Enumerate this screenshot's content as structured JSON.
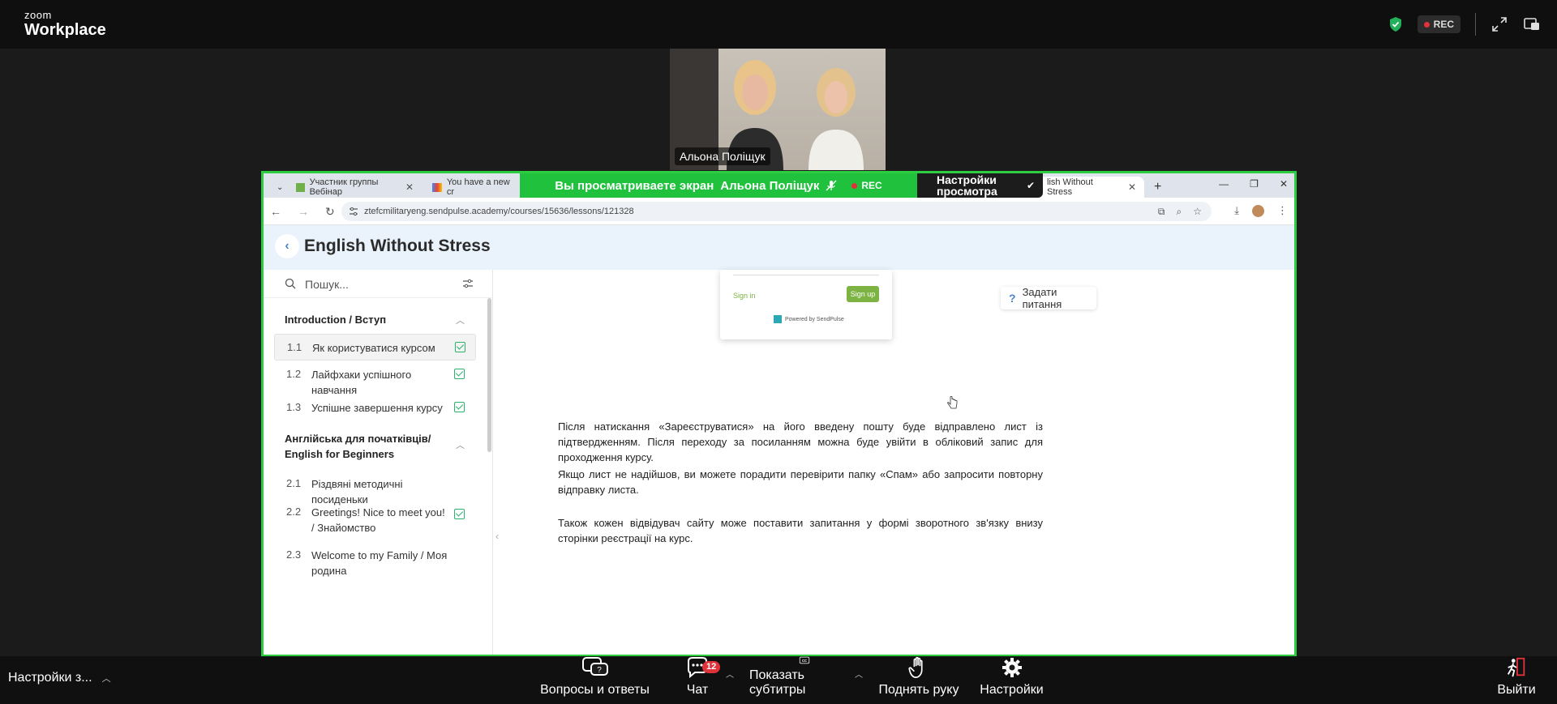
{
  "zoom": {
    "logo_line1": "zoom",
    "logo_line2": "Workplace",
    "rec_label": "REC",
    "participant_name": "Альона Поліщук",
    "share_banner": "Вы просматриваете экран",
    "share_presenter": "Альона Поліщук",
    "view_settings_line1": "Настройки",
    "view_settings_line2": "просмотра",
    "bottom_left_label": "Настройки з...",
    "toolbar": [
      {
        "label": "Вопросы и ответы",
        "icon": "qa-icon"
      },
      {
        "label": "Чат",
        "icon": "chat-icon",
        "badge": "12"
      },
      {
        "label": "Показать субтитры",
        "icon": "cc-icon"
      },
      {
        "label": "Поднять руку",
        "icon": "raise-hand-icon"
      },
      {
        "label": "Настройки",
        "icon": "gear-icon"
      }
    ],
    "leave_label": "Выйти",
    "accent_green": "#20c23d",
    "rec_color": "#e0323a"
  },
  "browser": {
    "tabs": [
      {
        "title": "Участник группы Вебінар"
      },
      {
        "title": "You have a new cr"
      },
      {
        "title": "lish Without Stress"
      }
    ],
    "url": "ztefcmilitaryeng.sendpulse.academy/courses/15636/lessons/121328"
  },
  "course": {
    "title": "English Without Stress",
    "search_placeholder": "Пошук...",
    "sections": [
      {
        "title": "Introduction / Вступ",
        "lessons": [
          {
            "num": "1.1",
            "title": "Як користуватися курсом",
            "done": true
          },
          {
            "num": "1.2",
            "title": "Лайфхаки успішного навчання",
            "done": true
          },
          {
            "num": "1.3",
            "title": "Успішне завершення курсу",
            "done": true
          }
        ]
      },
      {
        "title": "Англійська для початківців/ English for Beginners",
        "lessons": [
          {
            "num": "2.1",
            "title": "Різдвяні методичні посиденьки",
            "done": false
          },
          {
            "num": "2.2",
            "title": "Greetings! Nice to meet you! / Знайомство",
            "done": true
          },
          {
            "num": "2.3",
            "title": "Welcome to my Family / Моя родина",
            "done": false
          }
        ]
      }
    ],
    "signup_card": {
      "signin": "Sign in",
      "signup": "Sign up",
      "powered": "Powered by SendPulse"
    },
    "ask_button": "Задати питання",
    "paragraphs": [
      "Після натискання «Зареєструватися» на його введену пошту буде відправлено лист із підтвердженням. Після переходу за посиланням можна буде увійти в обліковий запис для проходження курсу.",
      "Якщо лист не надійшов, ви можете порадити перевірити папку «Спам» або запросити повторну відправку листа.",
      "Також кожен відвідувач сайту може поставити запитання у формі зворотного зв'язку внизу сторінки реєстрації на курс."
    ]
  }
}
